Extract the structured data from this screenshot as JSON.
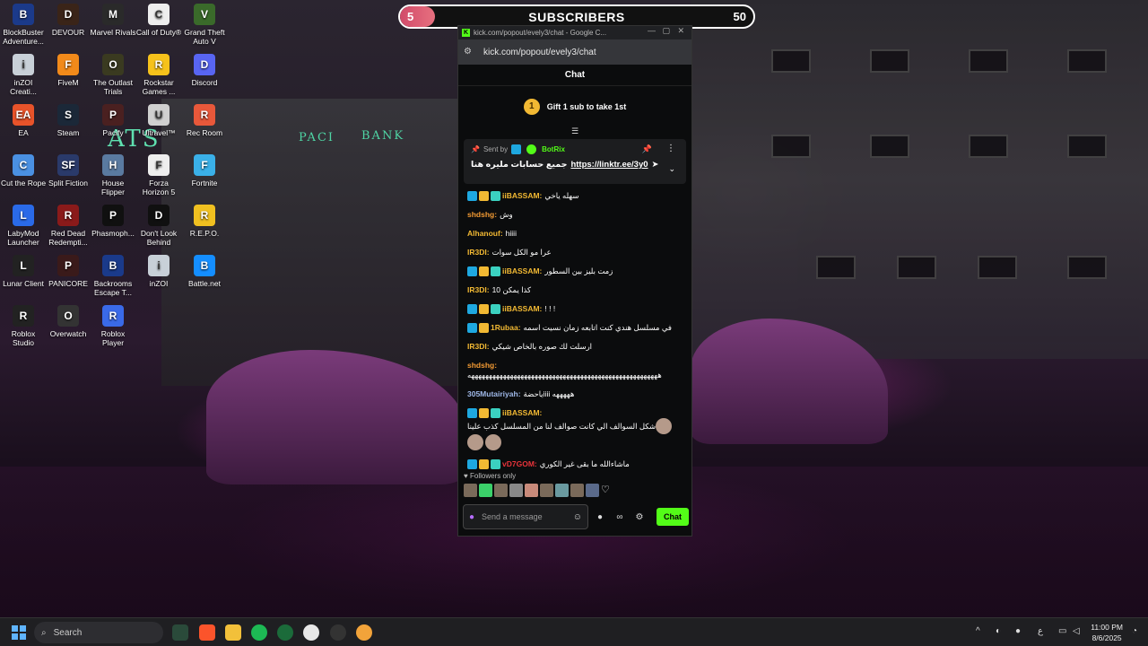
{
  "desktop_icons": [
    {
      "label": "BlockBuster Adventure...",
      "color": "#1b3a8a",
      "glyph": "B"
    },
    {
      "label": "DEVOUR",
      "color": "#3a2418",
      "glyph": "D"
    },
    {
      "label": "Marvel Rivals",
      "color": "#2a2a2a",
      "glyph": "M"
    },
    {
      "label": "Call of Duty®",
      "color": "#eeeeee",
      "glyph": "C"
    },
    {
      "label": "Grand Theft Auto V",
      "color": "#3a6a2a",
      "glyph": "V"
    },
    {
      "label": "inZOI Creati...",
      "color": "#c8d0d8",
      "glyph": "i"
    },
    {
      "label": "FiveM",
      "color": "#f28a1a",
      "glyph": "F"
    },
    {
      "label": "The Outlast Trials",
      "color": "#3a3a20",
      "glyph": "O"
    },
    {
      "label": "Rockstar Games ...",
      "color": "#f6c21b",
      "glyph": "R"
    },
    {
      "label": "Discord",
      "color": "#5865f2",
      "glyph": "D"
    },
    {
      "label": "EA",
      "color": "#e8532a",
      "glyph": "EA"
    },
    {
      "label": "Steam",
      "color": "#1b2838",
      "glyph": "S"
    },
    {
      "label": "Pacify",
      "color": "#4a2020",
      "glyph": "P"
    },
    {
      "label": "Ultravel™",
      "color": "#d0d0d0",
      "glyph": "U"
    },
    {
      "label": "Rec Room",
      "color": "#e8583a",
      "glyph": "R"
    },
    {
      "label": "Cut the Rope",
      "color": "#4a90e2",
      "glyph": "C"
    },
    {
      "label": "Split Fiction",
      "color": "#2a3a6a",
      "glyph": "SF"
    },
    {
      "label": "House Flipper",
      "color": "#5a7aa0",
      "glyph": "H"
    },
    {
      "label": "Forza Horizon 5",
      "color": "#eeeeee",
      "glyph": "F"
    },
    {
      "label": "Fortnite",
      "color": "#3ab0e8",
      "glyph": "F"
    },
    {
      "label": "LabyMod Launcher",
      "color": "#2a6ae8",
      "glyph": "L"
    },
    {
      "label": "Red Dead Redempti...",
      "color": "#8a1a1a",
      "glyph": "R"
    },
    {
      "label": "Phasmoph...",
      "color": "#101010",
      "glyph": "P"
    },
    {
      "label": "Don't Look Behind",
      "color": "#101010",
      "glyph": "D"
    },
    {
      "label": "R.E.P.O.",
      "color": "#f0c020",
      "glyph": "R"
    },
    {
      "label": "Lunar Client",
      "color": "#222222",
      "glyph": "L"
    },
    {
      "label": "PANICORE",
      "color": "#3a1a1a",
      "glyph": "P"
    },
    {
      "label": "Backrooms Escape T...",
      "color": "#1a3a8a",
      "glyph": "B"
    },
    {
      "label": "inZOI",
      "color": "#c8d0d8",
      "glyph": "i"
    },
    {
      "label": "Battle.net",
      "color": "#148eff",
      "glyph": "B"
    },
    {
      "label": "Roblox Studio",
      "color": "#222222",
      "glyph": "R"
    },
    {
      "label": "Overwatch",
      "color": "#333333",
      "glyph": "O"
    },
    {
      "label": "Roblox Player",
      "color": "#3a6ae8",
      "glyph": "R"
    }
  ],
  "wallpaper": {
    "sign_left": "PACI",
    "sign_right": "BANK",
    "sign_ats": "ATS"
  },
  "subscriber_goal": {
    "current": "5",
    "label": "SUBSCRIBERS",
    "goal": "50",
    "progress": 0.1
  },
  "popup": {
    "title": "kick.com/popout/evely3/chat - Google C...",
    "url": "kick.com/popout/evely3/chat",
    "chat_header": "Chat",
    "gift_badge": "1",
    "gift_text": "Gift 1 sub to take 1st",
    "pinned": {
      "sent_by": "Sent by",
      "bot_name": "BotRix",
      "text": "جميع حسابات مليره هنا",
      "link": "https://linktr.ee/3y0"
    },
    "messages": [
      {
        "user": "iiBASSAM:",
        "color": "#f2b933",
        "badges": [
          "vip",
          "crown",
          "sub"
        ],
        "text": "سهله ياخي"
      },
      {
        "user": "shdshg:",
        "color": "#f29a33",
        "badges": [],
        "text": "وش"
      },
      {
        "user": "Alhanouf:",
        "color": "#f2b933",
        "badges": [],
        "text": "hiiii"
      },
      {
        "user": "IR3DI:",
        "color": "#f2b933",
        "badges": [],
        "text": "عرا مو الكل سوات"
      },
      {
        "user": "iiBASSAM:",
        "color": "#f2b933",
        "badges": [
          "vip",
          "crown",
          "sub"
        ],
        "text": "زمت بليز بين السطور"
      },
      {
        "user": "IR3DI:",
        "color": "#f2b933",
        "badges": [],
        "text": "كذا يمكن 10"
      },
      {
        "user": "iiBASSAM:",
        "color": "#f2b933",
        "badges": [
          "vip",
          "crown",
          "sub"
        ],
        "text": "! ! !"
      },
      {
        "user": "1Rubaa:",
        "color": "#f2b933",
        "badges": [
          "vip",
          "crown"
        ],
        "text": "في مسلسل هندي كنت اتابعه زمان نسيت اسمه"
      },
      {
        "user": "IR3DI:",
        "color": "#f2b933",
        "badges": [],
        "text": "ارسلت لك صوره بالخاص شيكي"
      },
      {
        "user": "shdshg:",
        "color": "#f29a33",
        "badges": [],
        "text": "ههههههههههههههههههههههههههههههههههههههههههههههههههههههه"
      },
      {
        "user": "305Mutairiyah:",
        "color": "#9fb8e8",
        "badges": [],
        "text": "ياحضةiiii هههههه"
      },
      {
        "user": "iiBASSAM:",
        "color": "#f2b933",
        "badges": [
          "vip",
          "crown",
          "sub"
        ],
        "text": "شكل السوالف الي كانت صوالف لنا من المسلسل كذب علينا"
      },
      {
        "user": "vD7GOM:",
        "color": "#e8333a",
        "badges": [
          "vip",
          "crown",
          "sub"
        ],
        "text": "ماشاءالله ما بقى غير الكوري"
      }
    ],
    "followers_only": "Followers only",
    "input_placeholder": "Send a message",
    "chat_button": "Chat"
  },
  "taskbar": {
    "search_placeholder": "Search",
    "time": "11:00 PM",
    "date": "8/6/2025",
    "lang": "ع"
  }
}
